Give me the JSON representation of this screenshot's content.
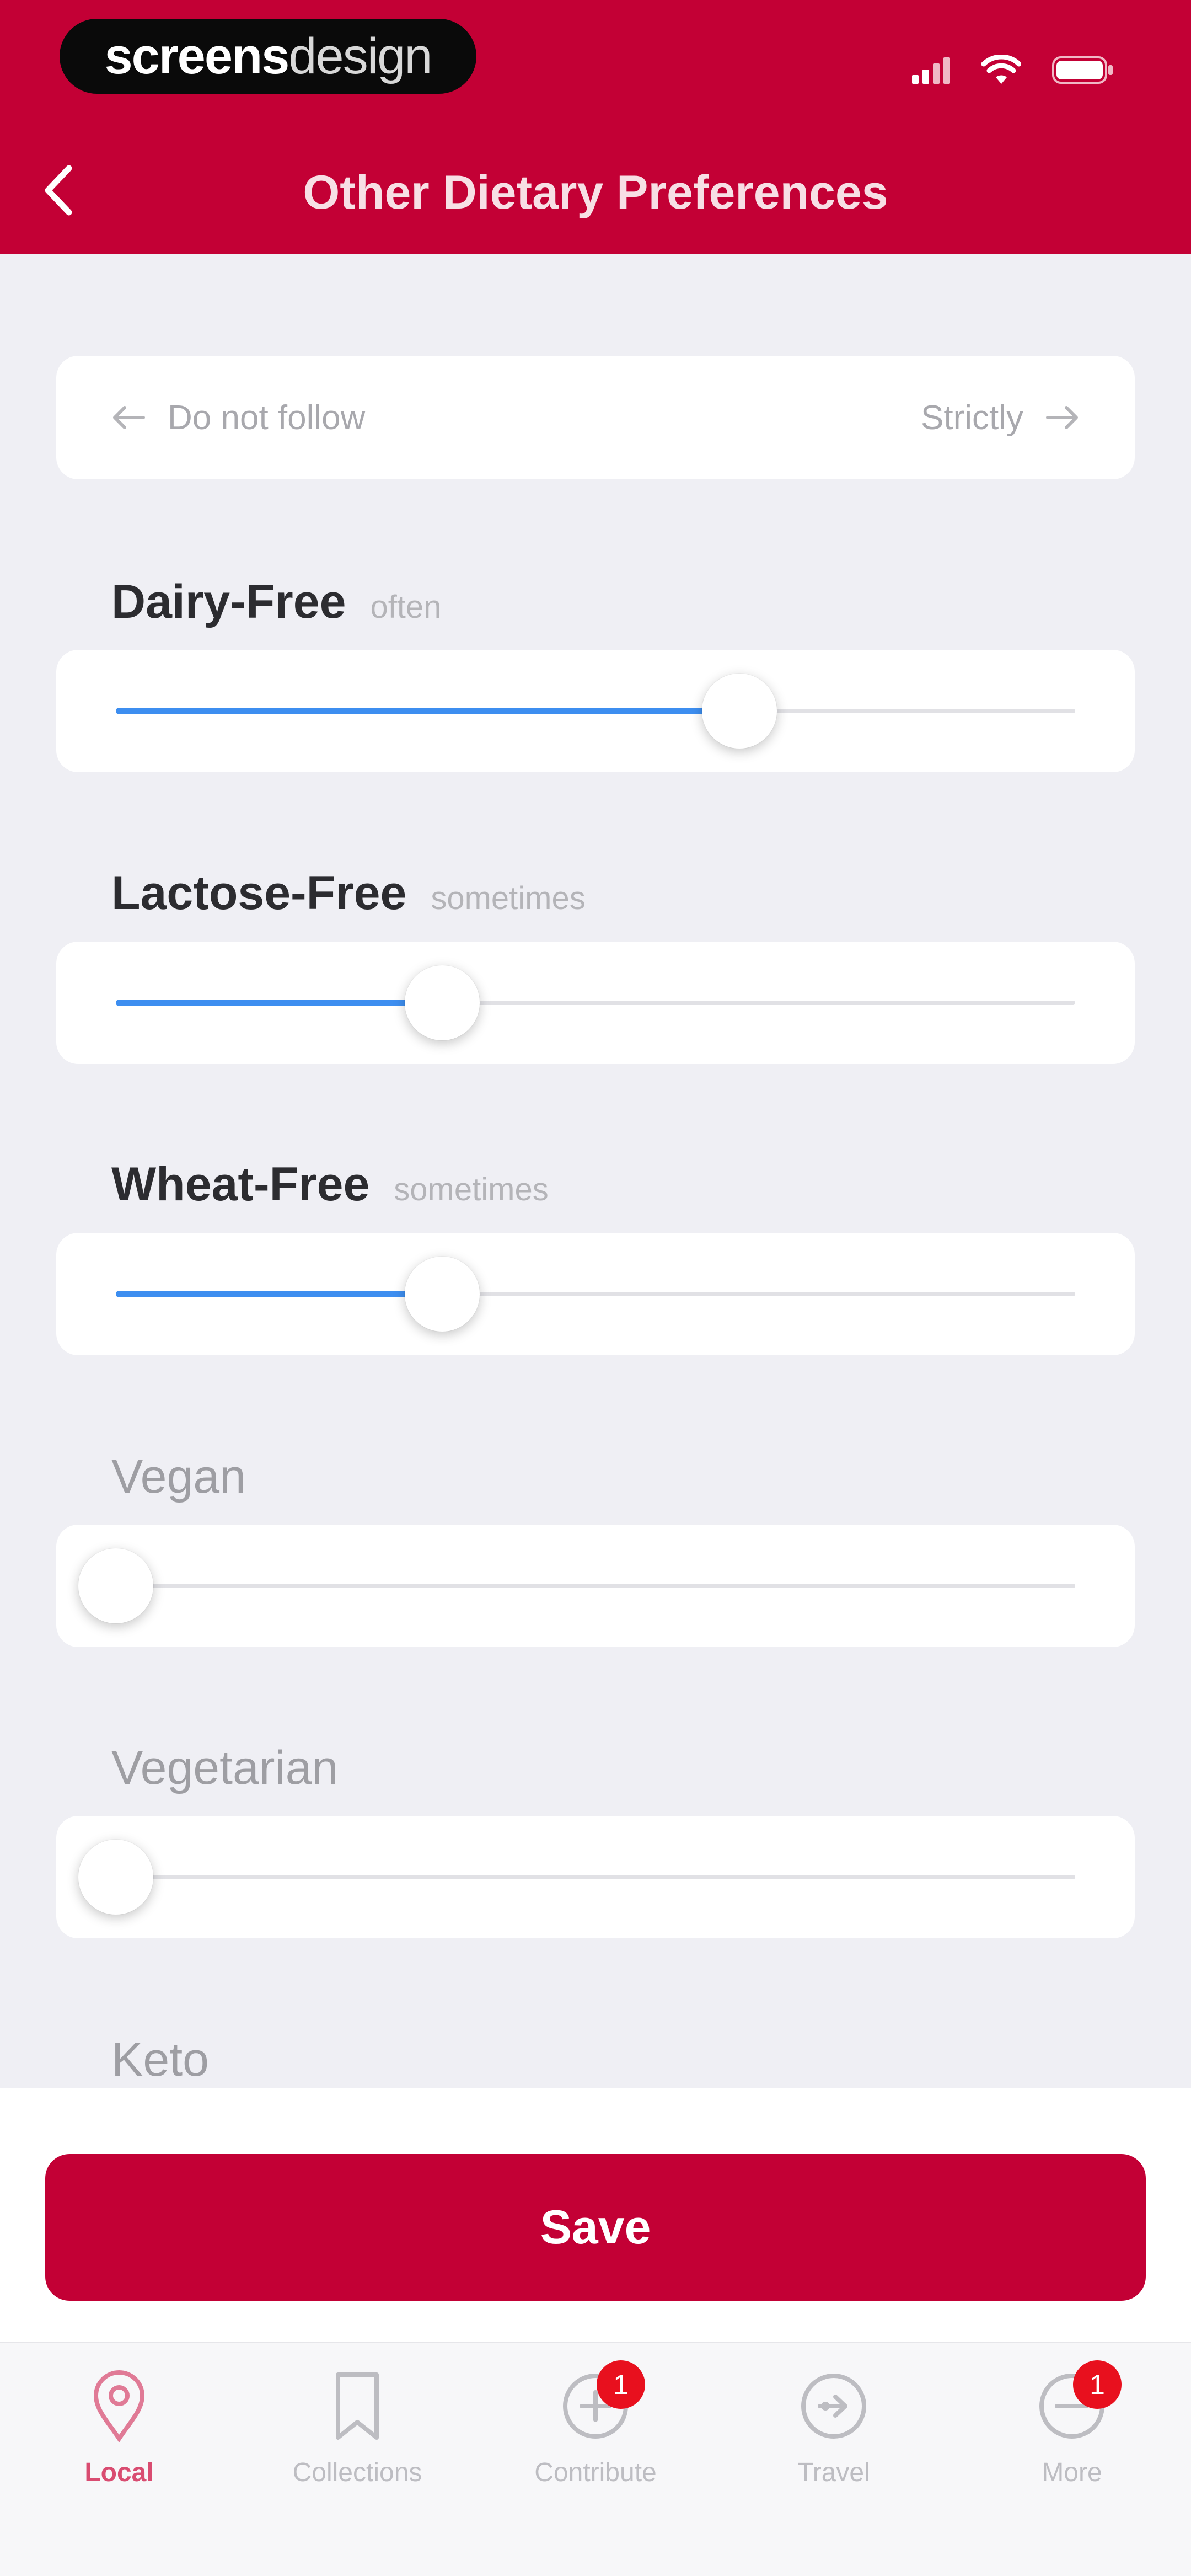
{
  "watermark": {
    "bold": "screens",
    "light": "design"
  },
  "header": {
    "title": "Other Dietary Preferences"
  },
  "legend": {
    "left_label": "Do not follow",
    "right_label": "Strictly"
  },
  "preferences": [
    {
      "name": "Dairy-Free",
      "level": "often",
      "value": 0.65,
      "active": true
    },
    {
      "name": "Lactose-Free",
      "level": "sometimes",
      "value": 0.34,
      "active": true
    },
    {
      "name": "Wheat-Free",
      "level": "sometimes",
      "value": 0.34,
      "active": true
    },
    {
      "name": "Vegan",
      "level": "",
      "value": 0.0,
      "active": false
    },
    {
      "name": "Vegetarian",
      "level": "",
      "value": 0.0,
      "active": false
    },
    {
      "name": "Keto",
      "level": "",
      "value": 0.0,
      "active": false
    }
  ],
  "save_label": "Save",
  "tabs": [
    {
      "label": "Local",
      "icon": "map-pin-icon",
      "badge": ""
    },
    {
      "label": "Collections",
      "icon": "bookmark-icon",
      "badge": ""
    },
    {
      "label": "Contribute",
      "icon": "plus-circle-icon",
      "badge": "1"
    },
    {
      "label": "Travel",
      "icon": "travel-circle-icon",
      "badge": ""
    },
    {
      "label": "More",
      "icon": "more-circle-icon",
      "badge": "1"
    }
  ],
  "colors": {
    "brand_red": "#c30035",
    "slider_blue": "#3d8ef0",
    "badge_red": "#e8101e",
    "active_tab": "#d94c71"
  }
}
